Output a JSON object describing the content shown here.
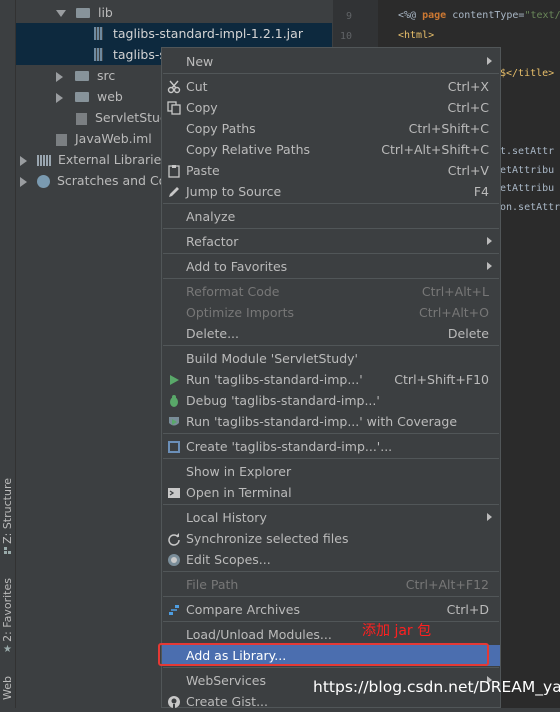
{
  "sidebar_tools": [
    {
      "label": "Z: Structure",
      "icon": "structure-icon"
    },
    {
      "label": "2: Favorites",
      "icon": "star-icon"
    },
    {
      "label": "Web",
      "icon": "web-icon"
    }
  ],
  "project_tree": {
    "items": [
      {
        "label": "lib",
        "icon": "folder-icon",
        "expanded": true
      },
      {
        "label": "taglibs-standard-impl-1.2.1.jar",
        "icon": "jar-icon"
      },
      {
        "label": "taglibs-st",
        "icon": "jar-icon"
      },
      {
        "label": "src",
        "icon": "folder-icon",
        "expanded": false
      },
      {
        "label": "web",
        "icon": "folder-icon",
        "expanded": false
      },
      {
        "label": "ServletStudy",
        "icon": "folder-icon"
      },
      {
        "label": "JavaWeb.iml",
        "icon": "iml-file-icon"
      },
      {
        "label": "External Libraries",
        "icon": "libraries-icon",
        "expanded": false
      },
      {
        "label": "Scratches and Cor",
        "icon": "scratches-icon",
        "expanded": false
      }
    ]
  },
  "editor": {
    "line_numbers": [
      "9",
      "10"
    ],
    "lines": {
      "directive_open": "<%@ ",
      "directive_kw": "page",
      "directive_attr": " contentType=",
      "directive_val": "\"text/",
      "html_tag": "<html>",
      "title_tag": "$</title>",
      "frag1": "t.setAttr",
      "frag2": "etAttribu",
      "frag3": "etAttribu",
      "frag4": "on.setAttr"
    }
  },
  "context_menu": {
    "items": [
      {
        "label": "New",
        "submenu": true
      },
      {
        "label": "Cut",
        "shortcut": "Ctrl+X",
        "icon": "scissors-icon"
      },
      {
        "label": "Copy",
        "shortcut": "Ctrl+C",
        "icon": "copy-icon"
      },
      {
        "label": "Copy Paths",
        "shortcut": "Ctrl+Shift+C"
      },
      {
        "label": "Copy Relative Paths",
        "shortcut": "Ctrl+Alt+Shift+C"
      },
      {
        "label": "Paste",
        "shortcut": "Ctrl+V",
        "icon": "clipboard-icon"
      },
      {
        "label": "Jump to Source",
        "shortcut": "F4",
        "icon": "pencil-icon"
      },
      {
        "label": "Analyze",
        "submenu": true
      },
      {
        "label": "Refactor",
        "submenu": true
      },
      {
        "label": "Add to Favorites",
        "submenu": true
      },
      {
        "label": "Reformat Code",
        "shortcut": "Ctrl+Alt+L",
        "disabled": true
      },
      {
        "label": "Optimize Imports",
        "shortcut": "Ctrl+Alt+O",
        "disabled": true
      },
      {
        "label": "Delete...",
        "shortcut": "Delete"
      },
      {
        "label": "Build Module 'ServletStudy'"
      },
      {
        "label": "Run 'taglibs-standard-imp...'",
        "shortcut": "Ctrl+Shift+F10",
        "icon": "run-icon"
      },
      {
        "label": "Debug 'taglibs-standard-imp...'",
        "icon": "debug-icon"
      },
      {
        "label": "Run 'taglibs-standard-imp...' with Coverage",
        "icon": "coverage-icon"
      },
      {
        "label": "Create 'taglibs-standard-imp...'...",
        "icon": "config-icon"
      },
      {
        "label": "Show in Explorer"
      },
      {
        "label": "Open in Terminal",
        "icon": "terminal-icon"
      },
      {
        "label": "Local History",
        "submenu": true
      },
      {
        "label": "Synchronize selected files",
        "icon": "sync-icon"
      },
      {
        "label": "Edit Scopes...",
        "icon": "scope-icon"
      },
      {
        "label": "File Path",
        "shortcut": "Ctrl+Alt+F12",
        "disabled": true
      },
      {
        "label": "Compare Archives",
        "shortcut": "Ctrl+D",
        "icon": "compare-icon"
      },
      {
        "label": "Load/Unload Modules..."
      },
      {
        "label": "Add as Library...",
        "highlighted": true
      },
      {
        "label": "WebServices",
        "submenu": true
      },
      {
        "label": "Create Gist...",
        "icon": "github-icon"
      }
    ]
  },
  "annotation": {
    "text": "添加 jar 包",
    "color": "#ff2020"
  },
  "watermark": "https://blog.csdn.net/DREAM_yao",
  "colors": {
    "highlight": "#4b6eaf",
    "selection": "#0d293e",
    "annotation_box": "#e53935"
  }
}
